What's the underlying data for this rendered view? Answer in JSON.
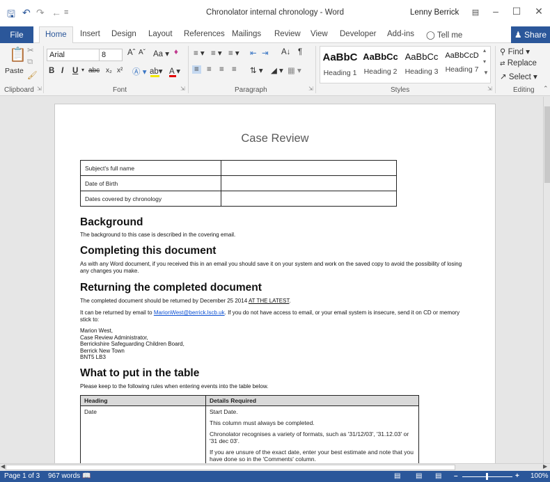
{
  "window": {
    "title": "Chronolator internal chronology - Word",
    "user": "Lenny Berrick"
  },
  "tabs": {
    "file": "File",
    "home": "Home",
    "insert": "Insert",
    "design": "Design",
    "layout": "Layout",
    "references": "References",
    "mailings": "Mailings",
    "review": "Review",
    "view": "View",
    "developer": "Developer",
    "addins": "Add-ins",
    "tellme": "Tell me",
    "share": "Share"
  },
  "ribbon": {
    "clipboard": {
      "paste": "Paste",
      "label": "Clipboard"
    },
    "font": {
      "name": "Arial",
      "size": "8",
      "label": "Font"
    },
    "paragraph": {
      "label": "Paragraph"
    },
    "styles": {
      "label": "Styles",
      "items": [
        {
          "sample": "AaBbC",
          "name": "Heading 1"
        },
        {
          "sample": "AaBbCc",
          "name": "Heading 2"
        },
        {
          "sample": "AaBbCc",
          "name": "Heading 3"
        },
        {
          "sample": "AaBbCcD",
          "name": "Heading 7"
        }
      ]
    },
    "editing": {
      "label": "Editing",
      "find": "Find",
      "replace": "Replace",
      "select": "Select"
    }
  },
  "document": {
    "title": "Case Review",
    "meta_rows": [
      "Subject's full name",
      "Date of Birth",
      "Dates covered by chronology"
    ],
    "background": {
      "heading": "Background",
      "text": "The background to this case is described in the covering email."
    },
    "completing": {
      "heading": "Completing this document",
      "text": "As with any Word document, if you received this in an email you should save it on your system and work on the saved copy to avoid the possibility of losing any changes you make."
    },
    "returning": {
      "heading": "Returning the completed document",
      "line1_a": "The completed document should be returned by December 25 2014 ",
      "line1_b": "AT THE LATEST",
      "line1_c": ".",
      "line2_a": "It can be returned by email to ",
      "email": "MarionWest@berrick.lscb.uk",
      "line2_b": ". If you do not have access to email, or your email system is insecure, send it on CD or memory stick to:",
      "address": [
        "Marion West,",
        "Case Review Administrator,",
        "Berrickshire Safeguarding Children Board,",
        "Berrick New Town",
        "BNT5 LB3"
      ]
    },
    "what": {
      "heading": "What to put in the table",
      "intro": "Please keep to the following rules when entering events into the table below.",
      "table_headers": [
        "Heading",
        "Details Required"
      ],
      "row1_heading": "Date",
      "row1_details": [
        "Start Date.",
        "This column must always be completed.",
        "Chronolator recognises a variety of formats, such as '31/12/03', '31.12.03' or '31 dec 03'.",
        "If you are unsure of the exact date, enter your best estimate and note that you have done so in the 'Comments' column."
      ]
    }
  },
  "status": {
    "page": "Page 1 of 3",
    "words": "967 words",
    "zoom": "100%"
  }
}
